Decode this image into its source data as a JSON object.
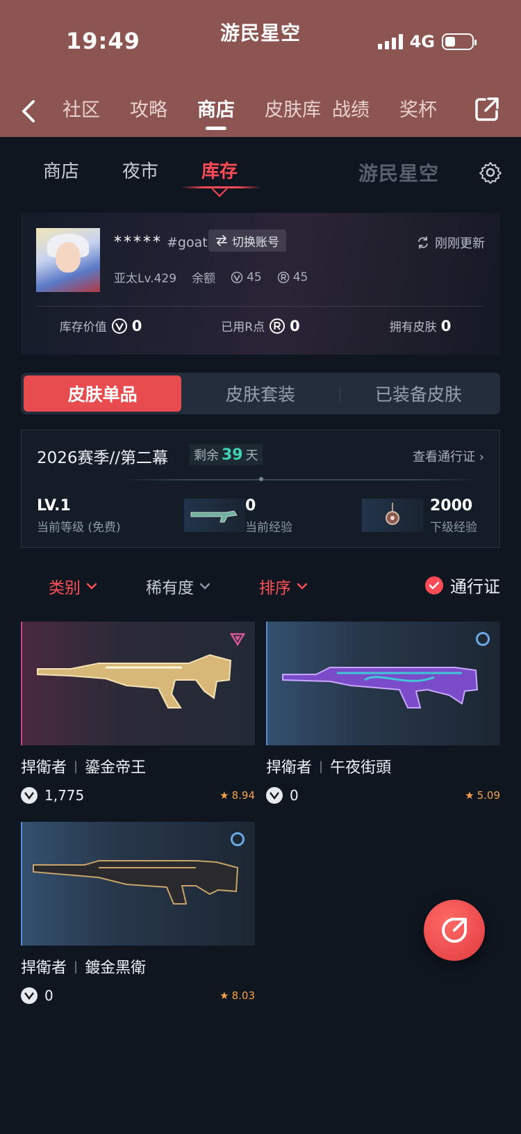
{
  "status": {
    "time": "19:49",
    "brand": "游民星空",
    "network": "4G"
  },
  "nav": {
    "tabs": [
      "社区",
      "攻略",
      "商店",
      "皮肤库",
      "战绩",
      "奖杯"
    ],
    "active_index": 2
  },
  "subtabs": {
    "items": [
      "商店",
      "夜市",
      "库存"
    ],
    "active_index": 2,
    "watermark": "游民星空"
  },
  "profile": {
    "username": "*****",
    "tag": "#goat",
    "switch_label": "切换账号",
    "refresh_label": "刚刚更新",
    "region_level": "亚太Lv.429",
    "balance_label": "余额",
    "vp_balance": "45",
    "rp_balance": "45",
    "stats": [
      {
        "label": "库存价值",
        "value": "0",
        "icon": "vp-icon"
      },
      {
        "label": "已用R点",
        "value": "0",
        "icon": "rp-icon"
      },
      {
        "label": "拥有皮肤",
        "value": "0",
        "icon": ""
      }
    ]
  },
  "segment": {
    "items": [
      "皮肤单品",
      "皮肤套装",
      "已装备皮肤"
    ],
    "active_index": 0
  },
  "season": {
    "title": "2026赛季//第二幕",
    "remain_label": "剩余",
    "remain_days": "39",
    "remain_unit": "天",
    "view_label": "查看通行证",
    "level": "LV.1",
    "level_label": "当前等级 (免费)",
    "current_exp": "0",
    "current_exp_label": "当前经验",
    "next_exp": "2000",
    "next_exp_label": "下级经验"
  },
  "filters": {
    "category": "类别",
    "rarity": "稀有度",
    "sort": "排序",
    "pass": "通行证"
  },
  "skins": [
    {
      "weapon": "捍衛者",
      "name": "鎏金帝王",
      "price": "1,775",
      "rating": "8.94",
      "tier": "purple"
    },
    {
      "weapon": "捍衛者",
      "name": "午夜街頭",
      "price": "0",
      "rating": "5.09",
      "tier": "blue"
    },
    {
      "weapon": "捍衛者",
      "name": "鍍金黑衛",
      "price": "0",
      "rating": "8.03",
      "tier": "blue"
    }
  ],
  "colors": {
    "header": "#8c5551",
    "accent": "#ff4b55",
    "background": "#0f1620",
    "rating": "#f5a24b",
    "days": "#3fd2b4"
  }
}
